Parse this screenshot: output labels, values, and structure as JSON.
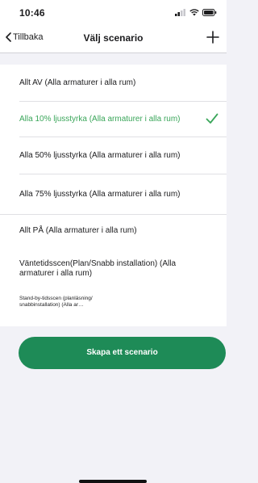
{
  "status_bar": {
    "time": "10:46"
  },
  "nav": {
    "back_label": "Tillbaka",
    "title": "Välj scenario"
  },
  "scenarios": [
    {
      "label": "Allt AV (Alla armaturer i alla rum)",
      "selected": false
    },
    {
      "label": "Alla 10% ljusstyrka (Alla armaturer i alla rum)",
      "selected": true
    },
    {
      "label": "Alla 50% ljusstyrka (Alla armaturer i alla rum)",
      "selected": false
    },
    {
      "label": "Alla 75% ljusstyrka (Alla armaturer i alla rum)",
      "selected": false
    },
    {
      "label": "Allt PÅ (Alla armaturer i alla rum)",
      "selected": false
    },
    {
      "label": "Väntetidsscen(Plan/Snabb installation) (Alla armaturer i alla rum)",
      "selected": false
    },
    {
      "label": "Stand-by-tidsscen (planläsning/ snabbinstallation) (Alla ar…",
      "selected": false
    }
  ],
  "create_button": {
    "label": "Skapa ett scenario"
  },
  "colors": {
    "accent_green": "#1e8b57",
    "selected_text": "#3aa65a",
    "background": "#f2f2f7"
  },
  "icons": {
    "back": "chevron-left-icon",
    "add": "plus-icon",
    "selected": "checkmark-icon",
    "signal": "cellular-signal-icon",
    "wifi": "wifi-icon",
    "battery": "battery-icon"
  }
}
